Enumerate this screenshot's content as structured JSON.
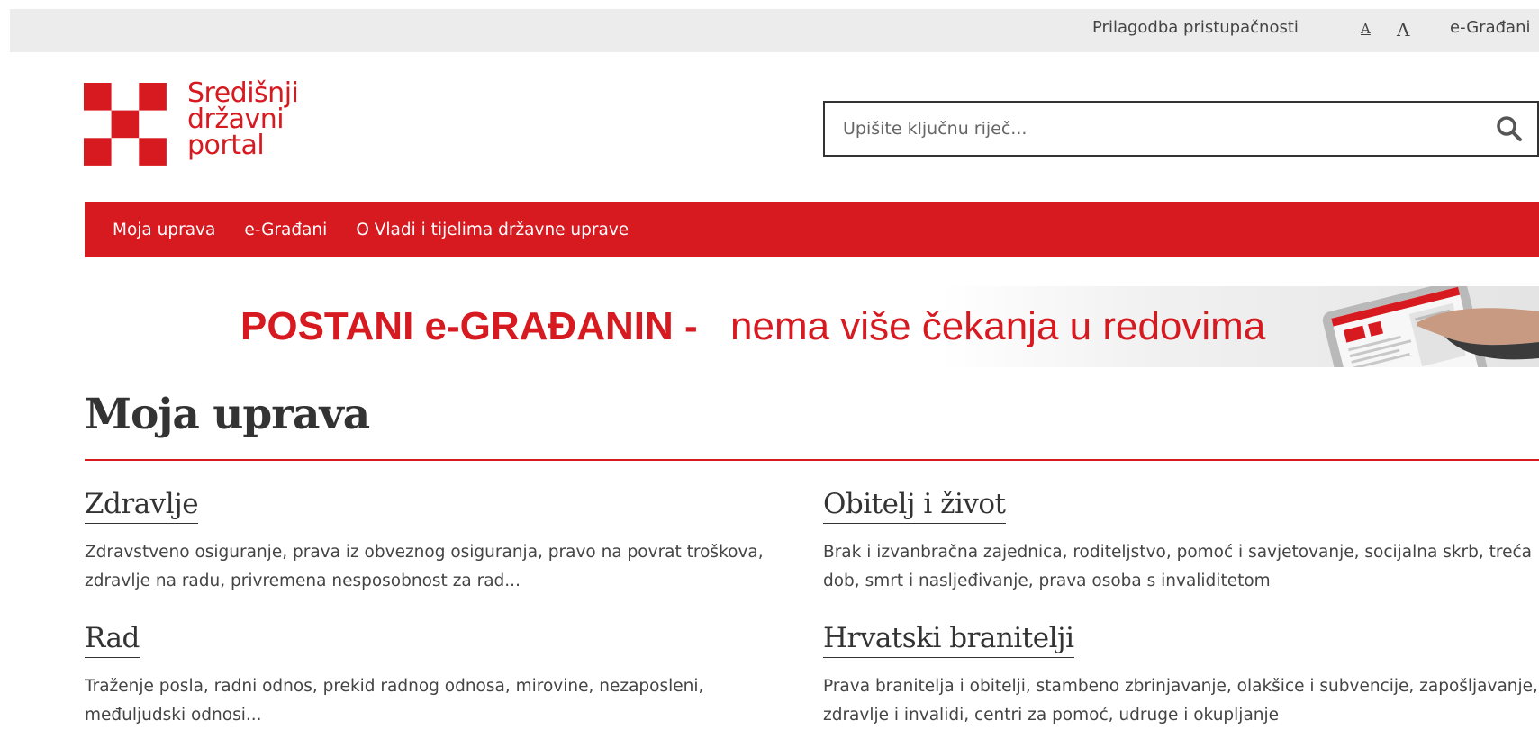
{
  "topbar": {
    "accessibility_label": "Prilagodba pristupačnosti",
    "font_small_label": "A",
    "font_large_label": "A",
    "egradani_label": "e-Građani"
  },
  "logo": {
    "line1": "Središnji",
    "line2": "državni",
    "line3": "portal",
    "brand_color": "#d71920"
  },
  "search": {
    "placeholder": "Upišite ključnu riječ...",
    "value": "",
    "icon": "search-icon"
  },
  "nav": {
    "items": [
      {
        "label": "Moja uprava"
      },
      {
        "label": "e-Građani"
      },
      {
        "label": "O Vladi i tijelima državne uprave"
      }
    ],
    "background": "#d71920"
  },
  "banner": {
    "bold_text": "POSTANI e-GRAĐANIN -",
    "light_text": "nema više čekanja u redovima",
    "image": "tablet-hand-illustration"
  },
  "main": {
    "title": "Moja uprava",
    "topics": [
      {
        "title": "Zdravlje",
        "description": "Zdravstveno osiguranje, prava iz obveznog osiguranja, pravo na povrat troškova, zdravlje na radu, privremena nesposobnost za rad..."
      },
      {
        "title": "Obitelj i život",
        "description": "Brak i izvanbračna zajednica, roditeljstvo, pomoć i savjetovanje, socijalna skrb, treća dob, smrt i nasljeđivanje, prava osoba s invaliditetom"
      },
      {
        "title": "Rad",
        "description": "Traženje posla, radni odnos, prekid radnog odnosa, mirovine, nezaposleni, međuljudski odnosi..."
      },
      {
        "title": "Hrvatski branitelji",
        "description": "Prava branitelja i obitelji, stambeno zbrinjavanje, olakšice i subvencije, zapošljavanje, zdravlje i invalidi, centri za pomoć, udruge i okupljanje"
      }
    ]
  }
}
